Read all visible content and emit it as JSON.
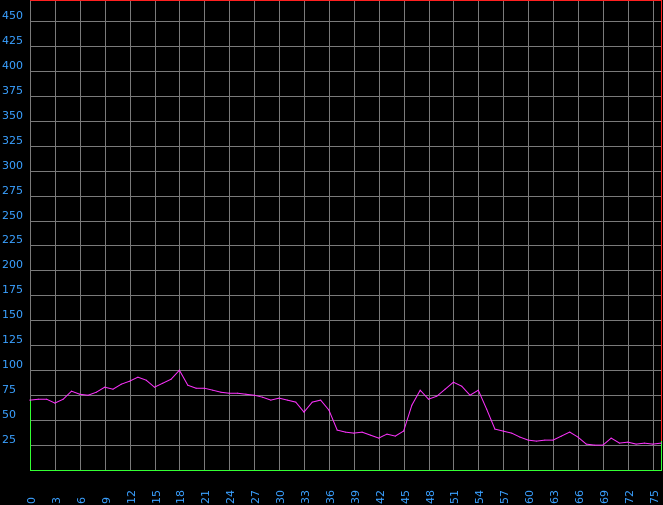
{
  "colors": {
    "background": "#000000",
    "grid": "#7a7a7a",
    "series": "#ff33ff",
    "tick_text": "#3aa0ff",
    "frame_top_right": "#ff2020",
    "frame_bottom": "#33ff33"
  },
  "chart_data": {
    "type": "line",
    "grid": true,
    "ylim": [
      0,
      470
    ],
    "xlim": [
      0,
      76
    ],
    "y_ticks": [
      25,
      50,
      75,
      100,
      125,
      150,
      175,
      200,
      225,
      250,
      275,
      300,
      325,
      350,
      375,
      400,
      425,
      450
    ],
    "y_tick_labels": [
      "25",
      "50",
      "75",
      "100",
      "125",
      "150",
      "175",
      "200",
      "225",
      "250",
      "275",
      "300",
      "325",
      "350",
      "375",
      "400",
      "425",
      "450"
    ],
    "x_ticks": [
      0,
      3,
      6,
      9,
      12,
      15,
      18,
      21,
      24,
      27,
      30,
      33,
      36,
      39,
      42,
      45,
      48,
      51,
      54,
      57,
      60,
      63,
      66,
      69,
      72,
      75
    ],
    "x_tick_labels": [
      "0",
      "3",
      "6",
      "9",
      "12",
      "15",
      "18",
      "21",
      "24",
      "27",
      "30",
      "33",
      "36",
      "39",
      "42",
      "45",
      "48",
      "51",
      "54",
      "57",
      "60",
      "63",
      "66",
      "69",
      "72",
      "75"
    ],
    "series": [
      {
        "x": [
          0,
          1,
          2,
          3,
          4,
          5,
          6,
          7,
          8,
          9,
          10,
          11,
          12,
          13,
          14,
          15,
          16,
          17,
          18,
          19,
          20,
          21,
          22,
          23,
          24,
          25,
          26,
          27,
          28,
          29,
          30,
          31,
          32,
          33,
          34,
          35,
          36,
          37,
          38,
          39,
          40,
          41,
          42,
          43,
          44,
          45,
          46,
          47,
          48,
          49,
          50,
          51,
          52,
          53,
          54,
          55,
          56,
          57,
          58,
          59,
          60,
          61,
          62,
          63,
          64,
          65,
          66,
          67,
          68,
          69,
          70,
          71,
          72,
          73,
          74,
          75,
          76
        ],
        "y": [
          70,
          71,
          71,
          67,
          71,
          79,
          76,
          75,
          78,
          83,
          81,
          86,
          89,
          93,
          90,
          83,
          87,
          91,
          100,
          85,
          82,
          82,
          80,
          78,
          77,
          77,
          76,
          75,
          73,
          70,
          72,
          70,
          68,
          58,
          68,
          70,
          60,
          40,
          38,
          37,
          38,
          35,
          32,
          36,
          34,
          39,
          65,
          80,
          71,
          74,
          81,
          88,
          84,
          75,
          80,
          61,
          41,
          39,
          37,
          33,
          30,
          29,
          30,
          30,
          34,
          38,
          33,
          26,
          25,
          25,
          32,
          27,
          28,
          26,
          27,
          26,
          27
        ]
      }
    ]
  }
}
